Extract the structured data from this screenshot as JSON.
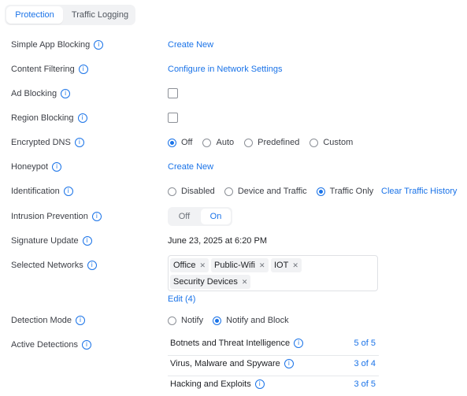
{
  "tabs": {
    "protection": "Protection",
    "traffic_logging": "Traffic Logging"
  },
  "rows": {
    "simple_app_blocking": {
      "label": "Simple App Blocking",
      "action": "Create New"
    },
    "content_filtering": {
      "label": "Content Filtering",
      "action": "Configure in Network Settings"
    },
    "ad_blocking": {
      "label": "Ad Blocking",
      "checked": false
    },
    "region_blocking": {
      "label": "Region Blocking",
      "checked": false
    },
    "encrypted_dns": {
      "label": "Encrypted DNS",
      "options": [
        "Off",
        "Auto",
        "Predefined",
        "Custom"
      ],
      "selected": "Off"
    },
    "honeypot": {
      "label": "Honeypot",
      "action": "Create New"
    },
    "identification": {
      "label": "Identification",
      "options": [
        "Disabled",
        "Device and Traffic",
        "Traffic Only"
      ],
      "selected": "Traffic Only",
      "action": "Clear Traffic History"
    },
    "intrusion_prevention": {
      "label": "Intrusion Prevention",
      "off": "Off",
      "on": "On",
      "value": "On"
    },
    "signature_update": {
      "label": "Signature Update",
      "value": "June 23, 2025 at 6:20 PM"
    },
    "selected_networks": {
      "label": "Selected Networks",
      "chips": [
        "Office",
        "Public-Wifi",
        "IOT",
        "Security Devices"
      ],
      "edit": "Edit (4)"
    },
    "detection_mode": {
      "label": "Detection Mode",
      "options": [
        "Notify",
        "Notify and Block"
      ],
      "selected": "Notify and Block"
    },
    "active_detections": {
      "label": "Active Detections",
      "items": [
        {
          "name": "Botnets and Threat Intelligence",
          "count": "5 of 5"
        },
        {
          "name": "Virus, Malware and Spyware",
          "count": "3 of 4"
        },
        {
          "name": "Hacking and Exploits",
          "count": "3 of 5"
        }
      ]
    }
  },
  "icons": {
    "info": "info-icon",
    "remove": "close-icon"
  },
  "colors": {
    "accent": "#1a73e8",
    "text": "#3c3f46",
    "tab_bg": "#f1f2f4",
    "border": "#dfe1e5"
  }
}
